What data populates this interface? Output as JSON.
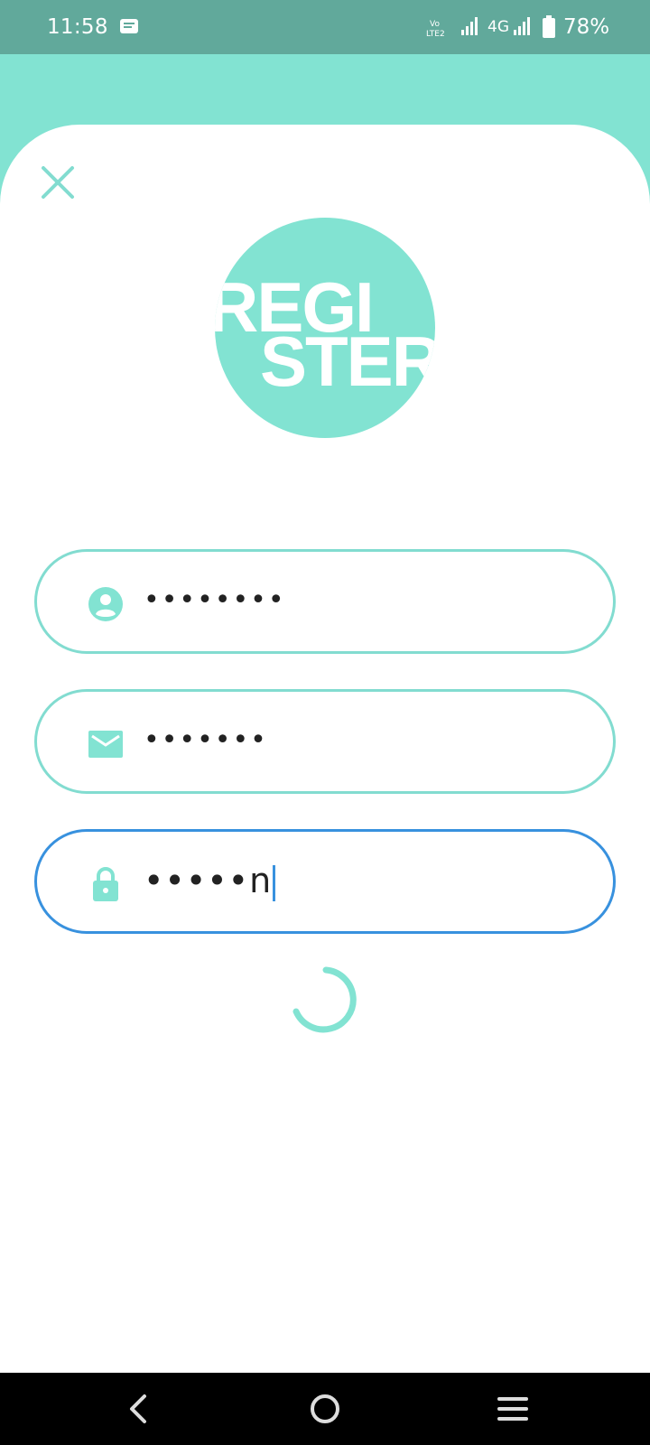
{
  "status_bar": {
    "time": "11:58",
    "network": "4G",
    "battery": "78%",
    "icons": [
      "message-icon",
      "volte-icon",
      "signal-icon",
      "signal-icon",
      "battery-icon"
    ]
  },
  "colors": {
    "accent": "#82e3d2",
    "status_bar": "#61a99b",
    "focus": "#3891de"
  },
  "logo": {
    "line1": "REGI",
    "line2": "STER"
  },
  "form": {
    "username": {
      "value": "••••••••",
      "icon": "user-icon"
    },
    "email": {
      "value": "•••••••",
      "icon": "mail-icon"
    },
    "password": {
      "value": "•••••n",
      "icon": "lock-icon",
      "focused": true
    }
  },
  "nav": {
    "icons": [
      "back-icon",
      "home-icon",
      "menu-icon"
    ]
  }
}
